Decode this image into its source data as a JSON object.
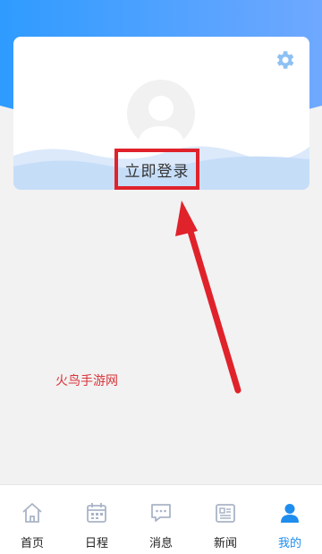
{
  "profile": {
    "login_label": "立即登录"
  },
  "watermark": "火鸟手游网",
  "tabs": [
    {
      "label": "首页",
      "icon": "home-icon",
      "active": false
    },
    {
      "label": "日程",
      "icon": "calendar-icon",
      "active": false
    },
    {
      "label": "消息",
      "icon": "message-icon",
      "active": false
    },
    {
      "label": "新闻",
      "icon": "news-icon",
      "active": false
    },
    {
      "label": "我的",
      "icon": "person-icon",
      "active": true
    }
  ],
  "colors": {
    "header_gradient_start": "#2f9bff",
    "header_gradient_end": "#6fa8ff",
    "accent": "#1f8ded",
    "annotation_red": "#e0222b",
    "tab_icon_gray": "#a9b4c6"
  }
}
